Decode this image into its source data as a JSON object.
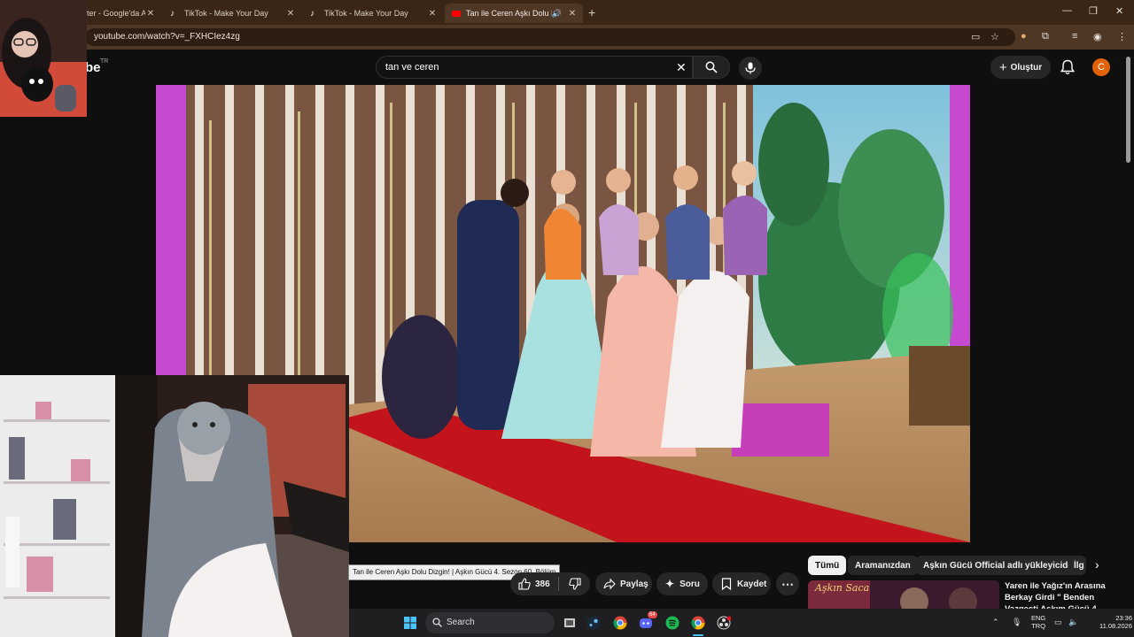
{
  "browser": {
    "tabs": [
      {
        "title": "ter - Google'da A",
        "active": false
      },
      {
        "title": "TikTok - Make Your Day",
        "active": false
      },
      {
        "title": "TikTok - Make Your Day",
        "active": false
      },
      {
        "title": "Tan ile Ceren Aşkı Dolu Dizgi",
        "active": true
      }
    ],
    "new_tab": "+",
    "url": "youtube.com/watch?v=_FXHCIez4zg"
  },
  "youtube": {
    "logo_fragment": "be",
    "region": "TR",
    "search": {
      "value": "tan ve ceren"
    },
    "create_label": "Oluştur",
    "avatar_letter": "C"
  },
  "video": {
    "tooltip": "Tan ile Ceren Aşkı Dolu Dizgin! | Aşkın Gücü 4. Sezon 60. Bölüm"
  },
  "actions": {
    "like_count": "386",
    "share_label": "Paylaş",
    "ask_label": "Soru",
    "save_label": "Kaydet"
  },
  "chips": [
    "Tümü",
    "Aramanızdan",
    "Aşkın Gücü Official adlı yükleyiciden",
    "İlg"
  ],
  "recommendation": {
    "thumb_text": "Aşkın Saca",
    "title": "Yaren ile Yağız'ın Arasına Berkay Girdi \" Benden Vazgeçti Aşkım Gücü 4"
  },
  "taskbar": {
    "search_label": "Search",
    "lang_1": "ENG",
    "lang_2": "TRQ",
    "time": "23:36",
    "date": "11.08.2026",
    "discord_badge": "64"
  },
  "colors": {
    "accent": "#ff0000",
    "avatar": "#e2620a",
    "tab_bar": "#3a2617"
  }
}
